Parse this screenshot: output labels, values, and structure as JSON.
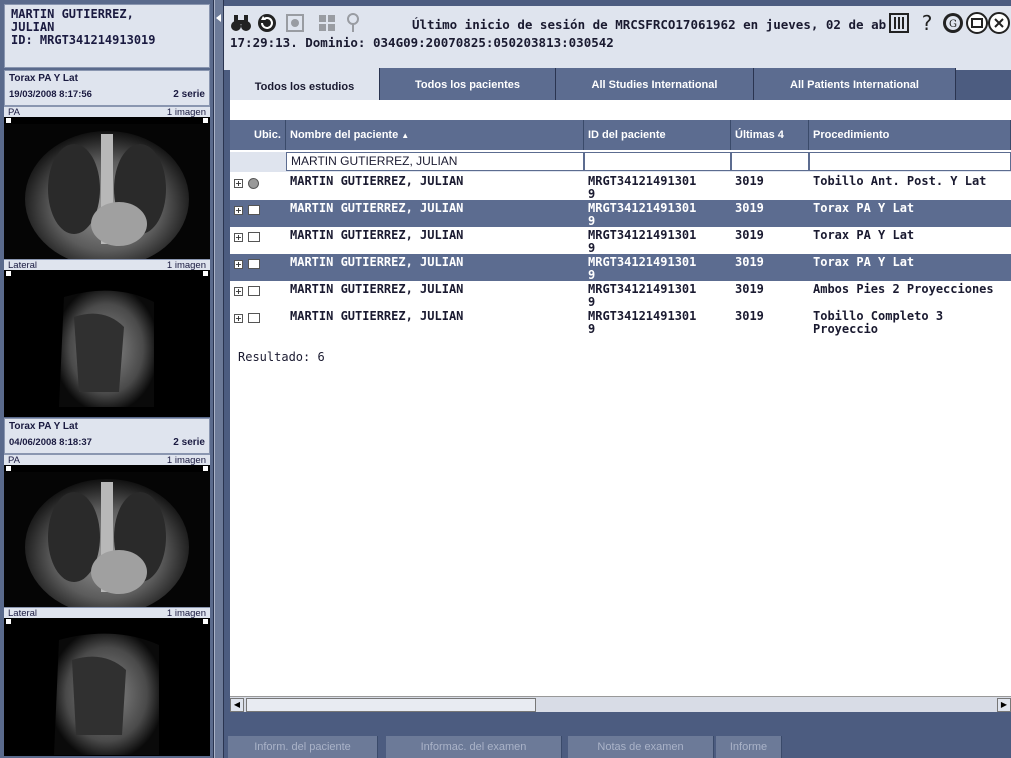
{
  "patient": {
    "name_line1": "MARTIN GUTIERREZ,",
    "name_line2": "JULIAN",
    "id_line": "ID: MRGT341214913019"
  },
  "studies": [
    {
      "title": "Torax PA Y Lat",
      "date": "19/03/2008 8:17:56",
      "series_count": "2 serie",
      "series": [
        {
          "label": "PA",
          "count": "1 imagen"
        },
        {
          "label": "Lateral",
          "count": "1 imagen"
        }
      ]
    },
    {
      "title": "Torax PA Y Lat",
      "date": "04/06/2008 8:18:37",
      "series_count": "2 serie",
      "series": [
        {
          "label": "PA",
          "count": "1 imagen"
        },
        {
          "label": "Lateral",
          "count": "1 imagen"
        }
      ]
    }
  ],
  "toolbar": {
    "icons": [
      "binoculars-icon",
      "refresh-icon",
      "import-icon",
      "grid-icon",
      "key-icon"
    ],
    "right_icons": [
      "settings-icon",
      "help-icon",
      "ge-logo-icon",
      "window-icon",
      "close-icon"
    ],
    "login_line1": "Último inicio de sesión de MRCSFRCO17061962 en jueves, 02 de ab",
    "login_line2": "17:29:13. Dominio: 034G09:20070825:050203813:030542"
  },
  "tabs": [
    "Todos los estudios",
    "Todos los pacientes",
    "All Studies International",
    "All Patients International"
  ],
  "table": {
    "columns": [
      "Ubic.",
      "Nombre del paciente",
      "ID del paciente",
      "Últimas 4",
      "Procedimiento"
    ],
    "filter_name": "MARTIN GUTIERREZ, JULIAN",
    "rows": [
      {
        "name": "MARTIN GUTIERREZ, JULIAN",
        "id1": "MRGT34121491301",
        "id2": "9",
        "last4": "3019",
        "proc": "Tobillo Ant. Post. Y Lat"
      },
      {
        "name": "MARTIN GUTIERREZ, JULIAN",
        "id1": "MRGT34121491301",
        "id2": "9",
        "last4": "3019",
        "proc": "Torax PA Y Lat"
      },
      {
        "name": "MARTIN GUTIERREZ, JULIAN",
        "id1": "MRGT34121491301",
        "id2": "9",
        "last4": "3019",
        "proc": "Torax PA Y Lat"
      },
      {
        "name": "MARTIN GUTIERREZ, JULIAN",
        "id1": "MRGT34121491301",
        "id2": "9",
        "last4": "3019",
        "proc": "Torax PA Y Lat"
      },
      {
        "name": "MARTIN GUTIERREZ, JULIAN",
        "id1": "MRGT34121491301",
        "id2": "9",
        "last4": "3019",
        "proc": "Ambos Pies 2 Proyecciones"
      },
      {
        "name": "MARTIN GUTIERREZ, JULIAN",
        "id1": "MRGT34121491301",
        "id2": "9",
        "last4": "3019",
        "proc": "Tobillo Completo 3 Proyeccio"
      }
    ],
    "result": "Resultado: 6"
  },
  "bottom_tabs": [
    "Inform. del paciente",
    "Informac. del examen",
    "Notas de examen",
    "Informe"
  ]
}
